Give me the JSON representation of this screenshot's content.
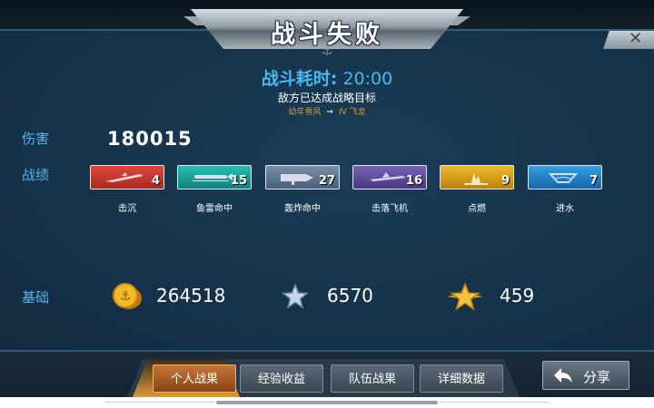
{
  "title": "战斗失败",
  "battle_time": {
    "label": "战斗耗时:",
    "value": "20:00"
  },
  "result_text": "敌方已达成战略目标",
  "ship_line": {
    "from": "幼年雪风",
    "to": "IV 飞龙"
  },
  "damage": {
    "label": "伤害",
    "value": "180015"
  },
  "record": {
    "label": "战绩",
    "items": [
      {
        "label": "击沉",
        "count": "4",
        "color": "#c8352c",
        "icon": "ship-sinking-icon"
      },
      {
        "label": "鱼雷命中",
        "count": "15",
        "color": "#1aa39a",
        "icon": "torpedo-icon"
      },
      {
        "label": "轰炸命中",
        "count": "27",
        "color": "#5d7691",
        "icon": "bomb-icon"
      },
      {
        "label": "击落飞机",
        "count": "16",
        "color": "#5e4a9a",
        "icon": "plane-icon"
      },
      {
        "label": "点燃",
        "count": "9",
        "color": "#d8a01e",
        "icon": "fire-icon"
      },
      {
        "label": "进水",
        "count": "7",
        "color": "#1f86c9",
        "icon": "flooding-icon"
      }
    ]
  },
  "base": {
    "label": "基础",
    "coins": "264518",
    "xp": "6570",
    "rank": "459"
  },
  "tabs": [
    "个人战果",
    "经验收益",
    "队伍战果",
    "详细数据"
  ],
  "active_tab": 0,
  "share_label": "分享",
  "colors": {
    "accent_blue": "#58b3ea",
    "active_tab": "#c5763a"
  }
}
